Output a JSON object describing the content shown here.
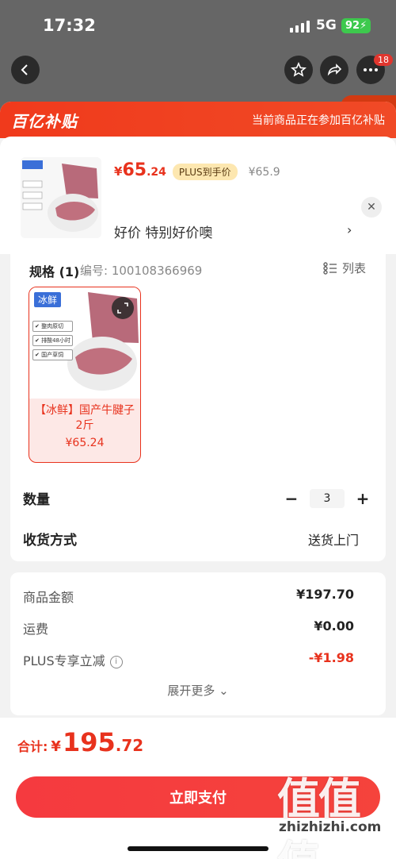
{
  "status_bar": {
    "time": "17:32",
    "network": "5G",
    "battery": "92"
  },
  "nav": {
    "notification_count": "18"
  },
  "sheet_header": {
    "logo": "百亿补贴",
    "note": "当前商品正在参加百亿补贴"
  },
  "product": {
    "price_symbol": "¥",
    "price_int": "65",
    "price_dec": ".24",
    "plus_tag": "PLUS到手价",
    "original_price": "¥65.9",
    "slogan": "好价  特别好价噢"
  },
  "spec": {
    "title": "规格 (1)",
    "code": "编号: 100108366969",
    "list_label": "列表",
    "sku": {
      "tag": "冰鲜",
      "name": "【冰鲜】国产牛腱子 2斤",
      "price": "¥65.24"
    }
  },
  "quantity": {
    "label": "数量",
    "value": "3",
    "minus": "−",
    "plus": "+"
  },
  "shipping": {
    "label": "收货方式",
    "value": "送货上门"
  },
  "totals": {
    "goods_label": "商品金额",
    "goods_value": "¥197.70",
    "freight_label": "运费",
    "freight_value": "¥0.00",
    "plus_label": "PLUS专享立减",
    "plus_value": "-¥1.98",
    "expand_label": "展开更多"
  },
  "footer": {
    "total_label": "合计:",
    "total_symbol": "¥",
    "total_int": "195",
    "total_dec": ".72",
    "pay_label": "立即支付",
    "watermark": "值值值",
    "watermark_sub": "zhizhizhi.com"
  },
  "colors": {
    "accent": "#e8321d",
    "header": "#f03a1c",
    "pay": "#f53a3f"
  }
}
